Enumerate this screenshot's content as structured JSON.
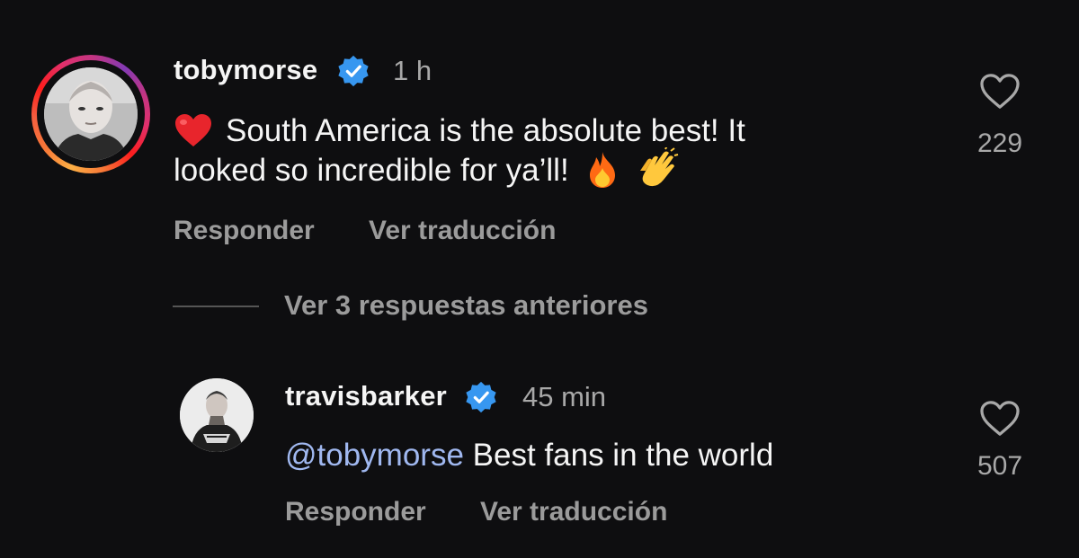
{
  "colors": {
    "background": "#0e0e10",
    "verified": "#3797f0",
    "mention": "#a0b8f0",
    "muted": "#9b9b9b"
  },
  "comments": [
    {
      "username": "tobymorse",
      "time": "1 h",
      "text_line1": "South America is the absolute best! It",
      "text_line2": "looked so incredible for ya’ll!",
      "leading_icon": "red-heart-emoji",
      "trailing_icons": [
        "fire-emoji",
        "clapping-hands-emoji"
      ],
      "reply_label": "Responder",
      "translate_label": "Ver traducción",
      "likes": "229"
    },
    {
      "username": "travisbarker",
      "time": "45 min",
      "mention": "@tobymorse",
      "text": " Best fans in the world",
      "reply_label": "Responder",
      "translate_label": "Ver traducción",
      "likes": "507"
    }
  ],
  "view_replies_label": "Ver 3 respuestas anteriores"
}
